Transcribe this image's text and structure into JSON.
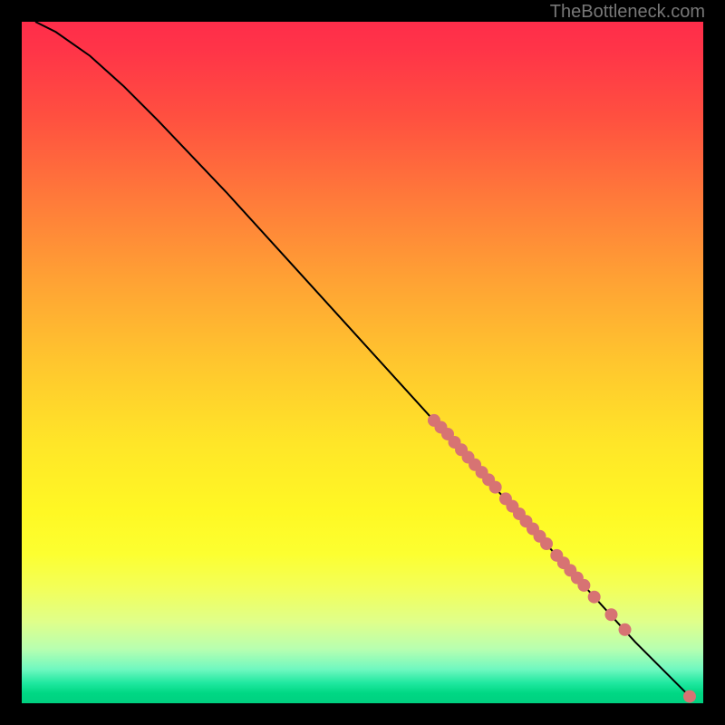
{
  "watermark": "TheBottleneck.com",
  "chart_data": {
    "type": "line",
    "title": "",
    "xlabel": "",
    "ylabel": "",
    "xlim": [
      0,
      100
    ],
    "ylim": [
      0,
      100
    ],
    "grid": false,
    "curve": [
      {
        "x": 2,
        "y": 100
      },
      {
        "x": 5,
        "y": 98.5
      },
      {
        "x": 10,
        "y": 95
      },
      {
        "x": 15,
        "y": 90.5
      },
      {
        "x": 20,
        "y": 85.5
      },
      {
        "x": 30,
        "y": 75
      },
      {
        "x": 40,
        "y": 64
      },
      {
        "x": 50,
        "y": 53
      },
      {
        "x": 60,
        "y": 42
      },
      {
        "x": 70,
        "y": 31
      },
      {
        "x": 80,
        "y": 20
      },
      {
        "x": 90,
        "y": 9
      },
      {
        "x": 98,
        "y": 1
      }
    ],
    "markers": [
      {
        "x": 60.5,
        "y": 41.5
      },
      {
        "x": 61.5,
        "y": 40.5
      },
      {
        "x": 62.5,
        "y": 39.5
      },
      {
        "x": 63.5,
        "y": 38.3
      },
      {
        "x": 64.5,
        "y": 37.2
      },
      {
        "x": 65.5,
        "y": 36.1
      },
      {
        "x": 66.5,
        "y": 35.0
      },
      {
        "x": 67.5,
        "y": 33.9
      },
      {
        "x": 68.5,
        "y": 32.8
      },
      {
        "x": 69.5,
        "y": 31.7
      },
      {
        "x": 71.0,
        "y": 30.0
      },
      {
        "x": 72.0,
        "y": 28.9
      },
      {
        "x": 73.0,
        "y": 27.8
      },
      {
        "x": 74.0,
        "y": 26.7
      },
      {
        "x": 75.0,
        "y": 25.6
      },
      {
        "x": 76.0,
        "y": 24.5
      },
      {
        "x": 77.0,
        "y": 23.4
      },
      {
        "x": 78.5,
        "y": 21.7
      },
      {
        "x": 79.5,
        "y": 20.6
      },
      {
        "x": 80.5,
        "y": 19.5
      },
      {
        "x": 81.5,
        "y": 18.4
      },
      {
        "x": 82.5,
        "y": 17.3
      },
      {
        "x": 84.0,
        "y": 15.6
      },
      {
        "x": 86.5,
        "y": 13.0
      },
      {
        "x": 88.5,
        "y": 10.8
      },
      {
        "x": 98.0,
        "y": 1.0
      }
    ],
    "marker_color": "#d77373",
    "marker_radius": 7,
    "line_color": "#000000"
  }
}
